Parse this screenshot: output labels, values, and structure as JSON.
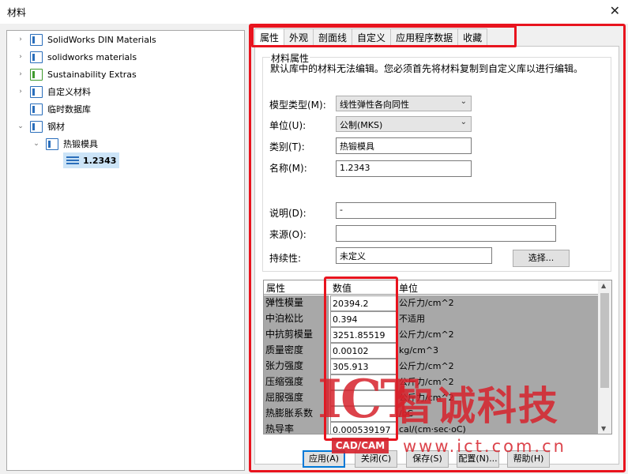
{
  "window": {
    "title": "材料"
  },
  "tree": {
    "nodes": [
      {
        "label": "SolidWorks DIN Materials",
        "arrow": "›",
        "icon": "library-icon"
      },
      {
        "label": "solidworks materials",
        "arrow": "›",
        "icon": "library-icon"
      },
      {
        "label": "Sustainability Extras",
        "arrow": "›",
        "icon": "green-library-icon"
      },
      {
        "label": "自定义材料",
        "arrow": "›",
        "icon": "library-icon"
      },
      {
        "label": "临时数据库",
        "arrow": "",
        "icon": "library-icon"
      },
      {
        "label": "钢材",
        "arrow": "⌄",
        "icon": "library-icon"
      },
      {
        "label": "热锻模具",
        "arrow": "⌄",
        "icon": "folder-icon"
      },
      {
        "label": "1.2343",
        "arrow": "",
        "icon": "material-icon"
      }
    ]
  },
  "tabs": [
    "属性",
    "外观",
    "剖面线",
    "自定义",
    "应用程序数据",
    "收藏"
  ],
  "properties": {
    "group_label": "材料属性",
    "description": "默认库中的材料无法编辑。您必须首先将材料复制到自定义库以进行编辑。",
    "model_type_label": "模型类型(M):",
    "model_type_value": "线性弹性各向同性",
    "units_label": "单位(U):",
    "units_value": "公制(MKS)",
    "category_label": "类别(T):",
    "category_value": "热锻模具",
    "name_label": "名称(M):",
    "name_value": "1.2343",
    "description_label": "说明(D):",
    "description_value": "-",
    "source_label": "来源(O):",
    "source_value": "",
    "sustainability_label": "持续性:",
    "sustainability_value": "未定义",
    "select_button": "选择..."
  },
  "table": {
    "headers": [
      "属性",
      "数值",
      "单位"
    ],
    "rows": [
      {
        "prop": "弹性模量",
        "value": "20394.2",
        "unit": "公斤力/cm^2"
      },
      {
        "prop": "中泊松比",
        "value": "0.394",
        "unit": "不适用"
      },
      {
        "prop": "中抗剪模量",
        "value": "3251.85519",
        "unit": "公斤力/cm^2"
      },
      {
        "prop": "质量密度",
        "value": "0.00102",
        "unit": "kg/cm^3"
      },
      {
        "prop": "张力强度",
        "value": "305.913",
        "unit": "公斤力/cm^2"
      },
      {
        "prop": "压缩强度",
        "value": "",
        "unit": "公斤力/cm^2"
      },
      {
        "prop": "屈服强度",
        "value": "",
        "unit": "公斤力/cm^2"
      },
      {
        "prop": "热膨胀系数",
        "value": "",
        "unit": "/oC"
      },
      {
        "prop": "热导率",
        "value": "0.000539197",
        "unit": "cal/(cm·sec·oC)"
      }
    ]
  },
  "buttons": {
    "apply": "应用(A)",
    "close": "关闭(C)",
    "save": "保存(S)",
    "config": "配置(N)...",
    "help": "帮助(H)"
  },
  "watermark": {
    "brand": "ICT",
    "cn": "智诚科技",
    "badge": "CAD/CAM",
    "url": "www.ict.com.cn"
  }
}
